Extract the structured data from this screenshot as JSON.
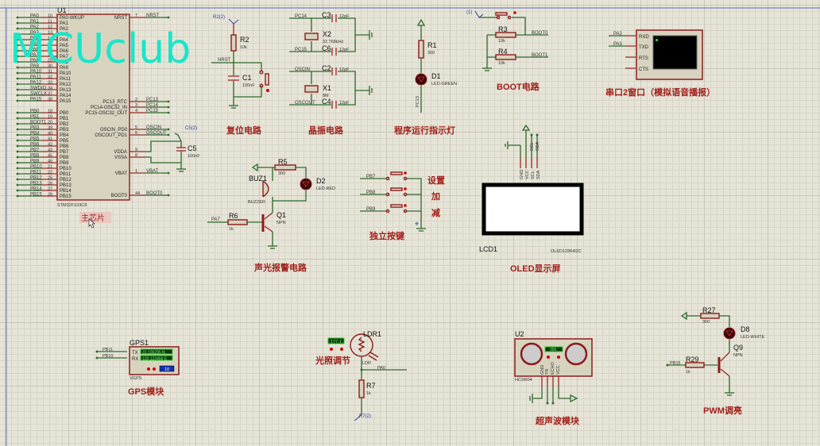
{
  "watermark": "MCUclub",
  "u1": {
    "ref": "U1",
    "part": "STM32F103C8",
    "label": "主芯片",
    "left_pins": [
      {
        "net": "PA0",
        "num": "10",
        "pin": "PA0-WKUP"
      },
      {
        "net": "PA1",
        "num": "11",
        "pin": "PA1"
      },
      {
        "net": "PA2",
        "num": "12",
        "pin": "PA2"
      },
      {
        "net": "PA3",
        "num": "13",
        "pin": "PA3"
      },
      {
        "net": "PA4",
        "num": "14",
        "pin": "PA4"
      },
      {
        "net": "PA5",
        "num": "15",
        "pin": "PA5"
      },
      {
        "net": "PA6",
        "num": "16",
        "pin": "PA6"
      },
      {
        "net": "PA7",
        "num": "17",
        "pin": "PA7"
      },
      {
        "net": "PA8",
        "num": "29",
        "pin": "PA8"
      },
      {
        "net": "PA9",
        "num": "30",
        "pin": "PA9"
      },
      {
        "net": "PA10",
        "num": "31",
        "pin": "PA10"
      },
      {
        "net": "PA11",
        "num": "32",
        "pin": "PA11"
      },
      {
        "net": "PA12",
        "num": "33",
        "pin": "PA12"
      },
      {
        "net": "SWDIO",
        "num": "34",
        "pin": "PA13"
      },
      {
        "net": "SWCLK",
        "num": "37",
        "pin": "PA14"
      },
      {
        "net": "PA15",
        "num": "38",
        "pin": "PA15"
      },
      {
        "net": "PB0",
        "num": "18",
        "pin": "PB0"
      },
      {
        "net": "PB1",
        "num": "19",
        "pin": "PB1"
      },
      {
        "net": "BOOT1",
        "num": "20",
        "pin": "PB2"
      },
      {
        "net": "PB3",
        "num": "39",
        "pin": "PB3"
      },
      {
        "net": "PB4",
        "num": "40",
        "pin": "PB4"
      },
      {
        "net": "PB5",
        "num": "41",
        "pin": "PB5"
      },
      {
        "net": "PB6",
        "num": "42",
        "pin": "PB6"
      },
      {
        "net": "PB7",
        "num": "43",
        "pin": "PB7"
      },
      {
        "net": "PB8",
        "num": "45",
        "pin": "PB8"
      },
      {
        "net": "PB9",
        "num": "46",
        "pin": "PB9"
      },
      {
        "net": "PB10",
        "num": "21",
        "pin": "PB10"
      },
      {
        "net": "PB11",
        "num": "22",
        "pin": "PB11"
      },
      {
        "net": "PB12",
        "num": "25",
        "pin": "PB12"
      },
      {
        "net": "PB13",
        "num": "26",
        "pin": "PB13"
      },
      {
        "net": "PB14",
        "num": "27",
        "pin": "PB14"
      },
      {
        "net": "PB15",
        "num": "28",
        "pin": "PB15"
      }
    ],
    "right_pins": [
      {
        "net": "NRST",
        "num": "7",
        "pin": "NRST"
      },
      {
        "net": "PC13",
        "num": "2",
        "pin": "PC13_RTC"
      },
      {
        "net": "PC14",
        "num": "3",
        "pin": "PC14-OSC32_IN"
      },
      {
        "net": "PC15",
        "num": "4",
        "pin": "PC15-OSC32_OUT"
      },
      {
        "net": "OSCIN",
        "num": "5",
        "pin": "OSCIN_PD0"
      },
      {
        "net": "OSCOUT",
        "num": "6",
        "pin": "OSCOUT_PD1"
      },
      {
        "net": "",
        "num": "9",
        "pin": "VDDA"
      },
      {
        "net": "",
        "num": "8",
        "pin": "VSSA"
      },
      {
        "net": "VBAT",
        "num": "1",
        "pin": "VBAT"
      },
      {
        "net": "BOOT0",
        "num": "44",
        "pin": "BOOT0"
      }
    ],
    "c5": {
      "ref": "C5",
      "value": "100nF",
      "probe": "C5(2)"
    }
  },
  "reset": {
    "title": "复位电路",
    "probe": "R2(2)",
    "r_ref": "R2",
    "r_val": "10k",
    "c_ref": "C1",
    "c_val": "100nF",
    "net": "NRST"
  },
  "crystal": {
    "title": "晶振电路",
    "nets": [
      "PC14",
      "PC15",
      "OSCIN",
      "OSCOUT"
    ],
    "caps": [
      {
        "ref": "C3",
        "value": "12pF"
      },
      {
        "ref": "C6",
        "value": "12pF"
      },
      {
        "ref": "C2",
        "value": "12pF"
      },
      {
        "ref": "C4",
        "value": "12pF"
      }
    ],
    "x2": {
      "ref": "X2",
      "value": "32.768kHz"
    },
    "x1": {
      "ref": "X1",
      "value": "8M"
    }
  },
  "indicator": {
    "title": "程序运行指示灯",
    "r_ref": "R1",
    "r_val": "300",
    "d_ref": "D1",
    "d_val": "LED-GREEN",
    "net": "PC13"
  },
  "boot": {
    "title": "BOOT电路",
    "probe": "(1)",
    "r3": "R3",
    "r3_val": "10k",
    "r4": "R4",
    "r4_val": "10k",
    "net0": "BOOT0",
    "net1": "BOOT1"
  },
  "serial": {
    "title": "串口2窗口（模拟语音播报）",
    "pins": [
      "RXD",
      "TXD",
      "RTS",
      "CTS"
    ],
    "nets": [
      "PA2",
      "PA3"
    ]
  },
  "alarm": {
    "title": "声光报警电路",
    "buz_ref": "BUZ1",
    "buz_val": "BUZZER",
    "r5": "R5",
    "r5_val": "300",
    "d2": "D2",
    "d2_val": "LED-RED",
    "q1": "Q1",
    "q1_val": "NPN",
    "r6": "R6",
    "r6_val": "1k",
    "net": "PA7"
  },
  "keys": {
    "title": "独立按键",
    "nets": [
      "PB7",
      "PB8",
      "PB9"
    ],
    "labels": [
      "设置",
      "加",
      "减"
    ]
  },
  "oled": {
    "title": "OLED显示屏",
    "ref": "LCD1",
    "part": "OLED12864I2C",
    "pins": [
      "GND",
      "VCC",
      "SCL",
      "SDA"
    ],
    "nets": [
      "SCL",
      "SDA"
    ]
  },
  "gps": {
    "title": "GPS模块",
    "ref": "GPS1",
    "part": "VGPS",
    "tx": "TX",
    "rx": "RX",
    "lat": "31.106295 N",
    "lon": "120.123456 E",
    "sats": "10",
    "nets": [
      "PB11",
      "PB10"
    ]
  },
  "ldr": {
    "title": "光照调节",
    "ref": "LDR1",
    "part": "LDR",
    "reading": "177.1",
    "net": "PA0",
    "r_ref": "R7",
    "r_val": "1k",
    "probe": "R7(2)"
  },
  "ultrasonic": {
    "title": "超声波模块",
    "ref": "U2",
    "part": "HCSR04",
    "reading": "350",
    "pins": [
      "GND",
      "TR",
      "ECHO",
      "VCC"
    ]
  },
  "pwm": {
    "title": "PWM调亮",
    "r27": "R27",
    "r27_val": "300",
    "d8": "D8",
    "d8_val": "LED-WHITE",
    "q9": "Q9",
    "q9_val": "NPN",
    "r29": "R29",
    "r29_val": "1k",
    "net": "PB15"
  },
  "colors": {
    "wire": "#2d6a2d",
    "component": "#8b1c1c",
    "title": "#a0201c",
    "watermark": "#19e6c8",
    "background": "#e6e4d6"
  }
}
